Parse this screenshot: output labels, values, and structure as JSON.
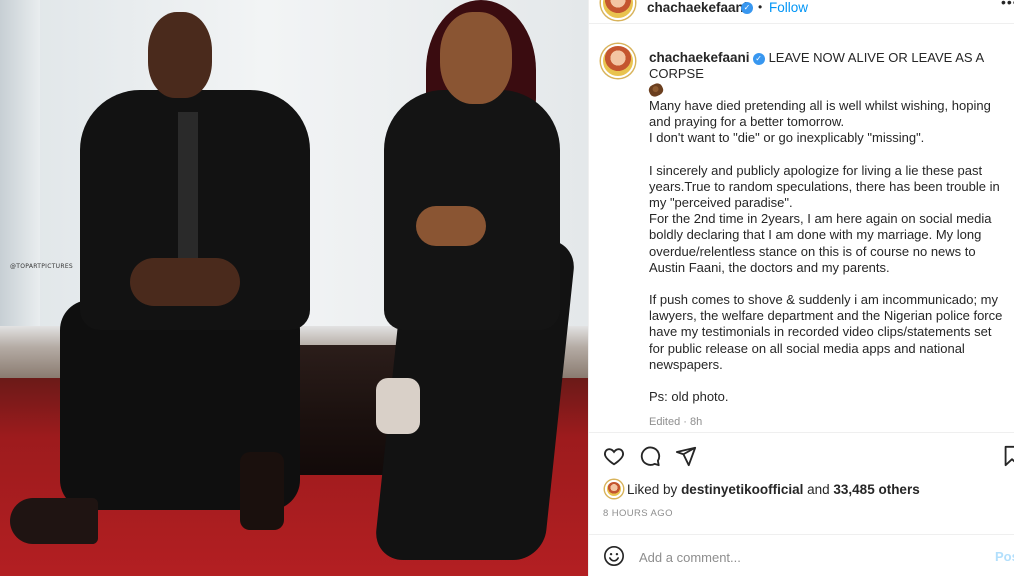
{
  "photo": {
    "watermark": "@TOPARTPICTURES"
  },
  "header": {
    "username": "chachaekefaani",
    "separator": "•",
    "follow_label": "Follow",
    "more_icon": "•••"
  },
  "caption": {
    "username": "chachaekefaani",
    "headline": "LEAVE NOW ALIVE OR LEAVE AS A CORPSE",
    "emoji_icon": "coffin-emoji",
    "paragraphs": [
      "Many have died pretending all is well whilst wishing, hoping and praying for a better tomorrow.\nI don't want to \"die\" or go inexplicably \"missing\".",
      "I sincerely and publicly apologize for living a lie these past years.True to random speculations, there has been trouble in my \"perceived paradise\".\nFor the 2nd time in 2years, I am here again on social media boldly declaring that I am done with my marriage. My long overdue/relentless stance on this is of course no news to Austin Faani, the doctors and my parents.",
      "If push comes to shove & suddenly i am incommunicado; my lawyers, the welfare department and the Nigerian police force have my testimonials in recorded video clips/statements set for public release on all social media apps and national newspapers.",
      "Ps: old photo."
    ],
    "edited": "Edited · 8h"
  },
  "actions": {
    "icons": [
      "heart-icon",
      "comment-icon",
      "share-icon",
      "bookmark-icon"
    ]
  },
  "likes": {
    "prefix": "Liked by",
    "liker": "destinyetikoofficial",
    "connector": "and",
    "others": "33,485 others"
  },
  "timestamp": "8 HOURS AGO",
  "comment": {
    "placeholder": "Add a comment...",
    "post_label": "Post"
  },
  "colors": {
    "link_blue": "#0095f6",
    "verified_blue": "#3897f0",
    "muted_grey": "#8e8e8e",
    "post_disabled": "#b2dffc"
  }
}
